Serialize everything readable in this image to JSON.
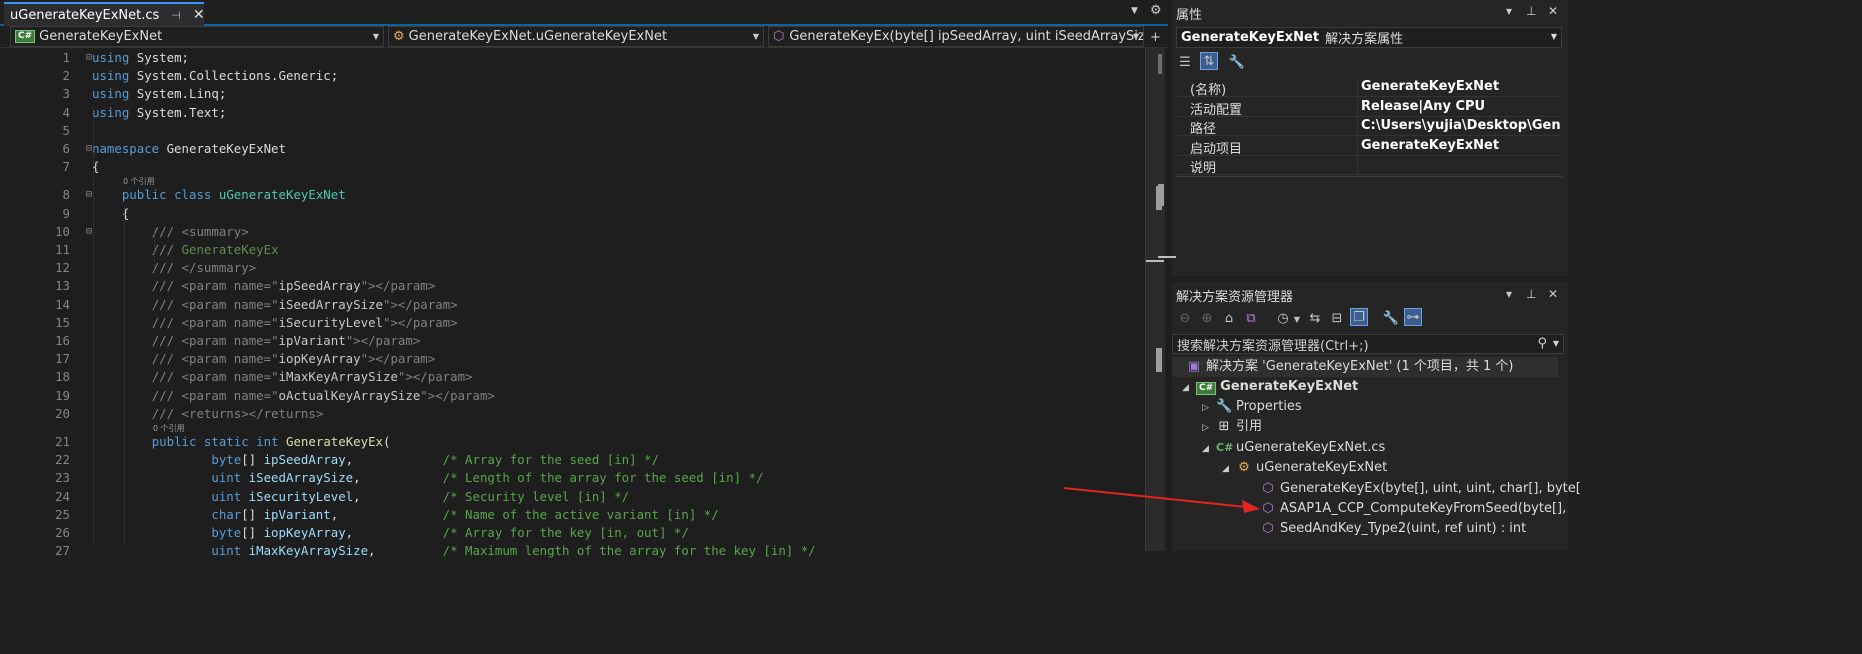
{
  "editor": {
    "tab_label": "uGenerateKeyExNet.cs",
    "nav_project": "GenerateKeyExNet",
    "nav_class": "GenerateKeyExNet.uGenerateKeyExNet",
    "nav_member": "GenerateKeyEx(byte[] ipSeedArray, uint iSeedArraySize",
    "cs_badge": "C#",
    "lens": "0 个引用",
    "lines": [
      {
        "n": "1",
        "html": "<span class=\"kw\">using</span> System;"
      },
      {
        "n": "2",
        "html": "<span class=\"kw\">using</span> System.Collections.Generic;"
      },
      {
        "n": "3",
        "html": "<span class=\"kw\">using</span> System.Linq;"
      },
      {
        "n": "4",
        "html": "<span class=\"kw\">using</span> System.Text;"
      },
      {
        "n": "5",
        "html": ""
      },
      {
        "n": "6",
        "html": "<span class=\"kw\">namespace</span> GenerateKeyExNet"
      },
      {
        "n": "7",
        "html": "{"
      },
      {
        "n": "8",
        "html": "    <span class=\"kw\">public</span> <span class=\"kw\">class</span> <span class=\"ty\">uGenerateKeyExNet</span>"
      },
      {
        "n": "9",
        "html": "    {"
      },
      {
        "n": "10",
        "html": "        <span class=\"tag\">///</span> <span class=\"tag\">&lt;summary&gt;</span>"
      },
      {
        "n": "11",
        "html": "        <span class=\"tag\">///</span> <span class=\"dc\">GenerateKeyEx</span>"
      },
      {
        "n": "12",
        "html": "        <span class=\"tag\">///</span> <span class=\"tag\">&lt;/summary&gt;</span>"
      },
      {
        "n": "13",
        "html": "        <span class=\"tag\">///</span> <span class=\"tag\">&lt;param</span> <span class=\"tag\">name=\"</span><span class=\"str\">ipSeedArray</span><span class=\"tag\">\"&gt;&lt;/param&gt;</span>"
      },
      {
        "n": "14",
        "html": "        <span class=\"tag\">///</span> <span class=\"tag\">&lt;param</span> <span class=\"tag\">name=\"</span><span class=\"str\">iSeedArraySize</span><span class=\"tag\">\"&gt;&lt;/param&gt;</span>"
      },
      {
        "n": "15",
        "html": "        <span class=\"tag\">///</span> <span class=\"tag\">&lt;param</span> <span class=\"tag\">name=\"</span><span class=\"str\">iSecurityLevel</span><span class=\"tag\">\"&gt;&lt;/param&gt;</span>"
      },
      {
        "n": "16",
        "html": "        <span class=\"tag\">///</span> <span class=\"tag\">&lt;param</span> <span class=\"tag\">name=\"</span><span class=\"str\">ipVariant</span><span class=\"tag\">\"&gt;&lt;/param&gt;</span>"
      },
      {
        "n": "17",
        "html": "        <span class=\"tag\">///</span> <span class=\"tag\">&lt;param</span> <span class=\"tag\">name=\"</span><span class=\"str\">iopKeyArray</span><span class=\"tag\">\"&gt;&lt;/param&gt;</span>"
      },
      {
        "n": "18",
        "html": "        <span class=\"tag\">///</span> <span class=\"tag\">&lt;param</span> <span class=\"tag\">name=\"</span><span class=\"str\">iMaxKeyArraySize</span><span class=\"tag\">\"&gt;&lt;/param&gt;</span>"
      },
      {
        "n": "19",
        "html": "        <span class=\"tag\">///</span> <span class=\"tag\">&lt;param</span> <span class=\"tag\">name=\"</span><span class=\"str\">oActualKeyArraySize</span><span class=\"tag\">\"&gt;&lt;/param&gt;</span>"
      },
      {
        "n": "20",
        "html": "        <span class=\"tag\">///</span> <span class=\"tag\">&lt;returns&gt;&lt;/returns&gt;</span>"
      },
      {
        "n": "21",
        "html": "        <span class=\"kw\">public</span> <span class=\"kw\">static</span> <span class=\"kw\">int</span> <span class=\"fn\">GenerateKeyEx</span>("
      },
      {
        "n": "22",
        "html": "                <span class=\"kw\">byte</span>[] <span class=\"id\">ipSeedArray</span>,            <span class=\"cm\">/* Array for the seed [in] */</span>"
      },
      {
        "n": "23",
        "html": "                <span class=\"kw\">uint</span> <span class=\"id\">iSeedArraySize</span>,           <span class=\"cm\">/* Length of the array for the seed [in] */</span>"
      },
      {
        "n": "24",
        "html": "                <span class=\"kw\">uint</span> <span class=\"id\">iSecurityLevel</span>,           <span class=\"cm\">/* Security level [in] */</span>"
      },
      {
        "n": "25",
        "html": "                <span class=\"kw\">char</span>[] <span class=\"id\">ipVariant</span>,              <span class=\"cm\">/* Name of the active variant [in] */</span>"
      },
      {
        "n": "26",
        "html": "                <span class=\"kw\">byte</span>[] <span class=\"id\">iopKeyArray</span>,            <span class=\"cm\">/* Array for the key [in, out] */</span>"
      },
      {
        "n": "27",
        "html": "                <span class=\"kw\">uint</span> <span class=\"id\">iMaxKeyArraySize</span>,         <span class=\"cm\">/* Maximum length of the array for the key [in] */</span>"
      }
    ]
  },
  "properties": {
    "title": "属性",
    "object_name": "GenerateKeyExNet",
    "object_type": "解决方案属性",
    "rows": [
      {
        "key": "(名称)",
        "value": "GenerateKeyExNet"
      },
      {
        "key": "活动配置",
        "value": "Release|Any CPU"
      },
      {
        "key": "路径",
        "value": "C:\\Users\\yujia\\Desktop\\Genera"
      },
      {
        "key": "启动项目",
        "value": "GenerateKeyExNet"
      },
      {
        "key": "说明",
        "value": ""
      }
    ]
  },
  "solution_explorer": {
    "title": "解决方案资源管理器",
    "search_placeholder": "搜索解决方案资源管理器(Ctrl+;)",
    "solution_label": "解决方案 'GenerateKeyExNet' (1 个项目，共 1 个)",
    "project_label": "GenerateKeyExNet",
    "properties_label": "Properties",
    "references_label": "引用",
    "file_label": "uGenerateKeyExNet.cs",
    "class_label": "uGenerateKeyExNet",
    "members": [
      "GenerateKeyEx(byte[], uint, uint, char[], byte[",
      "ASAP1A_CCP_ComputeKeyFromSeed(byte[],",
      "SeedAndKey_Type2(uint, ref uint) : int"
    ]
  },
  "colors": {
    "accent": "#0e639c",
    "annotation_arrow": "#e0261f"
  }
}
